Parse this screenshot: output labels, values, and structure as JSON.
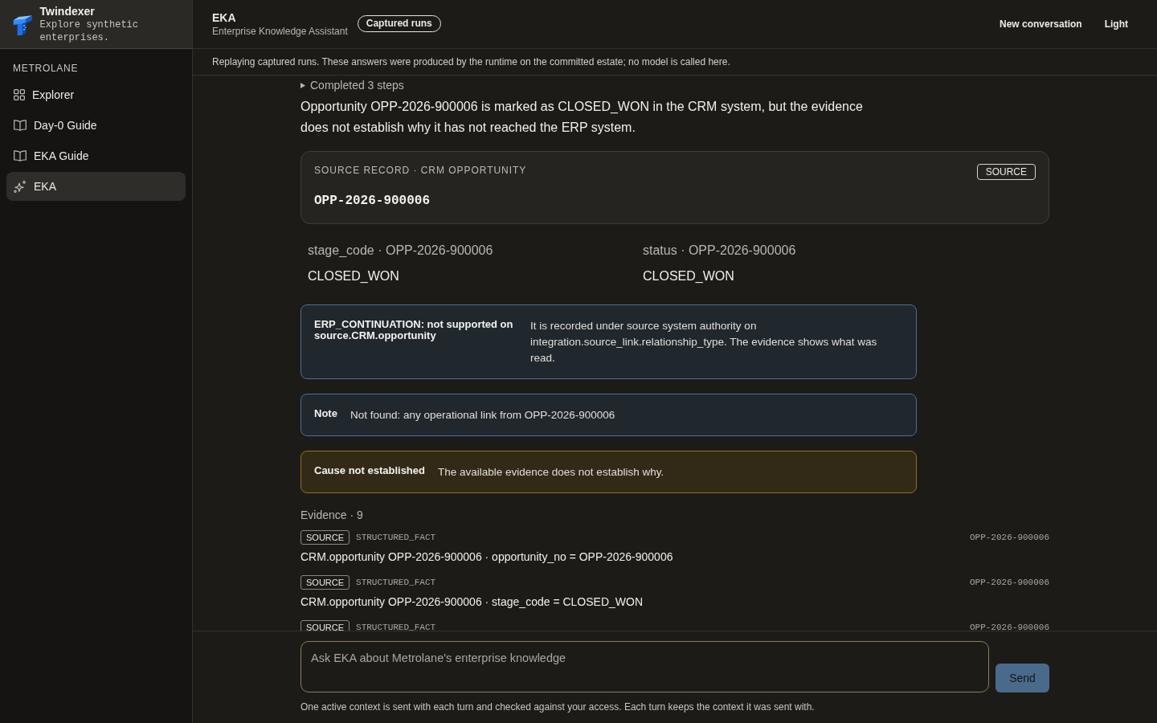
{
  "sidebar": {
    "brand": {
      "name": "Twindexer",
      "tagline": "Explore synthetic enterprises."
    },
    "section_label": "METROLANE",
    "items": [
      {
        "label": "Explorer",
        "kind": "grid",
        "selected": false
      },
      {
        "label": "Day-0 Guide",
        "kind": "book",
        "selected": false
      },
      {
        "label": "EKA Guide",
        "kind": "book",
        "selected": false
      },
      {
        "label": "EKA",
        "kind": "sparkle",
        "selected": true
      }
    ]
  },
  "header": {
    "title": "EKA",
    "subtitle": "Enterprise Knowledge Assistant",
    "badge": "Captured runs",
    "actions": [
      "New conversation",
      "Light"
    ]
  },
  "banner": "Replaying captured runs. These answers were produced by the runtime on the committed estate; no model is called here.",
  "answer": {
    "steps": {
      "label": "Completed 3 steps",
      "expanded": false
    },
    "summary": "Opportunity OPP-2026-900006 is marked as CLOSED_WON in the CRM system, but the evidence does not establish why it has not reached the ERP system.",
    "source_record": {
      "label": "SOURCE RECORD · CRM OPPORTUNITY",
      "id": "OPP-2026-900006",
      "tag": "SOURCE"
    },
    "fields": [
      {
        "label": "stage_code · OPP-2026-900006",
        "value": "CLOSED_WON"
      },
      {
        "label": "status · OPP-2026-900006",
        "value": "CLOSED_WON"
      }
    ],
    "callouts": [
      {
        "kind": "info",
        "title": "ERP_CONTINUATION: not supported on source.CRM.opportunity",
        "text": "It is recorded under source system authority on integration.source_link.relationship_type. The evidence shows what was read."
      },
      {
        "kind": "info",
        "title": "Note",
        "text": "Not found: any operational link from OPP-2026-900006"
      },
      {
        "kind": "warning",
        "title": "Cause not established",
        "text": "The available evidence does not establish why."
      }
    ],
    "evidence": {
      "title": "Evidence · 9",
      "items": [
        {
          "tag": "SOURCE",
          "type": "STRUCTURED_FACT",
          "ref": "OPP-2026-900006",
          "text": "CRM.opportunity OPP-2026-900006 · opportunity_no = OPP-2026-900006"
        },
        {
          "tag": "SOURCE",
          "type": "STRUCTURED_FACT",
          "ref": "OPP-2026-900006",
          "text": "CRM.opportunity OPP-2026-900006 · stage_code = CLOSED_WON"
        },
        {
          "tag": "SOURCE",
          "type": "STRUCTURED_FACT",
          "ref": "OPP-2026-900006"
        }
      ]
    }
  },
  "composer": {
    "placeholder": "Ask EKA about Metrolane's enterprise knowledge",
    "send": "Send",
    "note": "One active context is sent with each turn and checked against your access. Each turn keeps the context it was sent with."
  }
}
